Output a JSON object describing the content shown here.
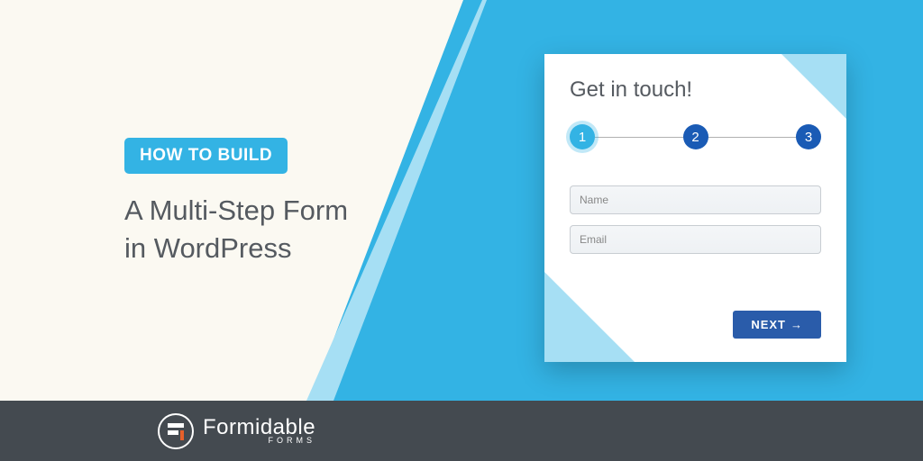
{
  "badge": "HOW TO BUILD",
  "headline_line1": "A Multi-Step Form",
  "headline_line2": "in WordPress",
  "form": {
    "title": "Get in touch!",
    "steps": [
      "1",
      "2",
      "3"
    ],
    "name_placeholder": "Name",
    "email_placeholder": "Email",
    "next_label": "NEXT"
  },
  "brand": {
    "name": "Formidable",
    "sub": "FORMS"
  }
}
